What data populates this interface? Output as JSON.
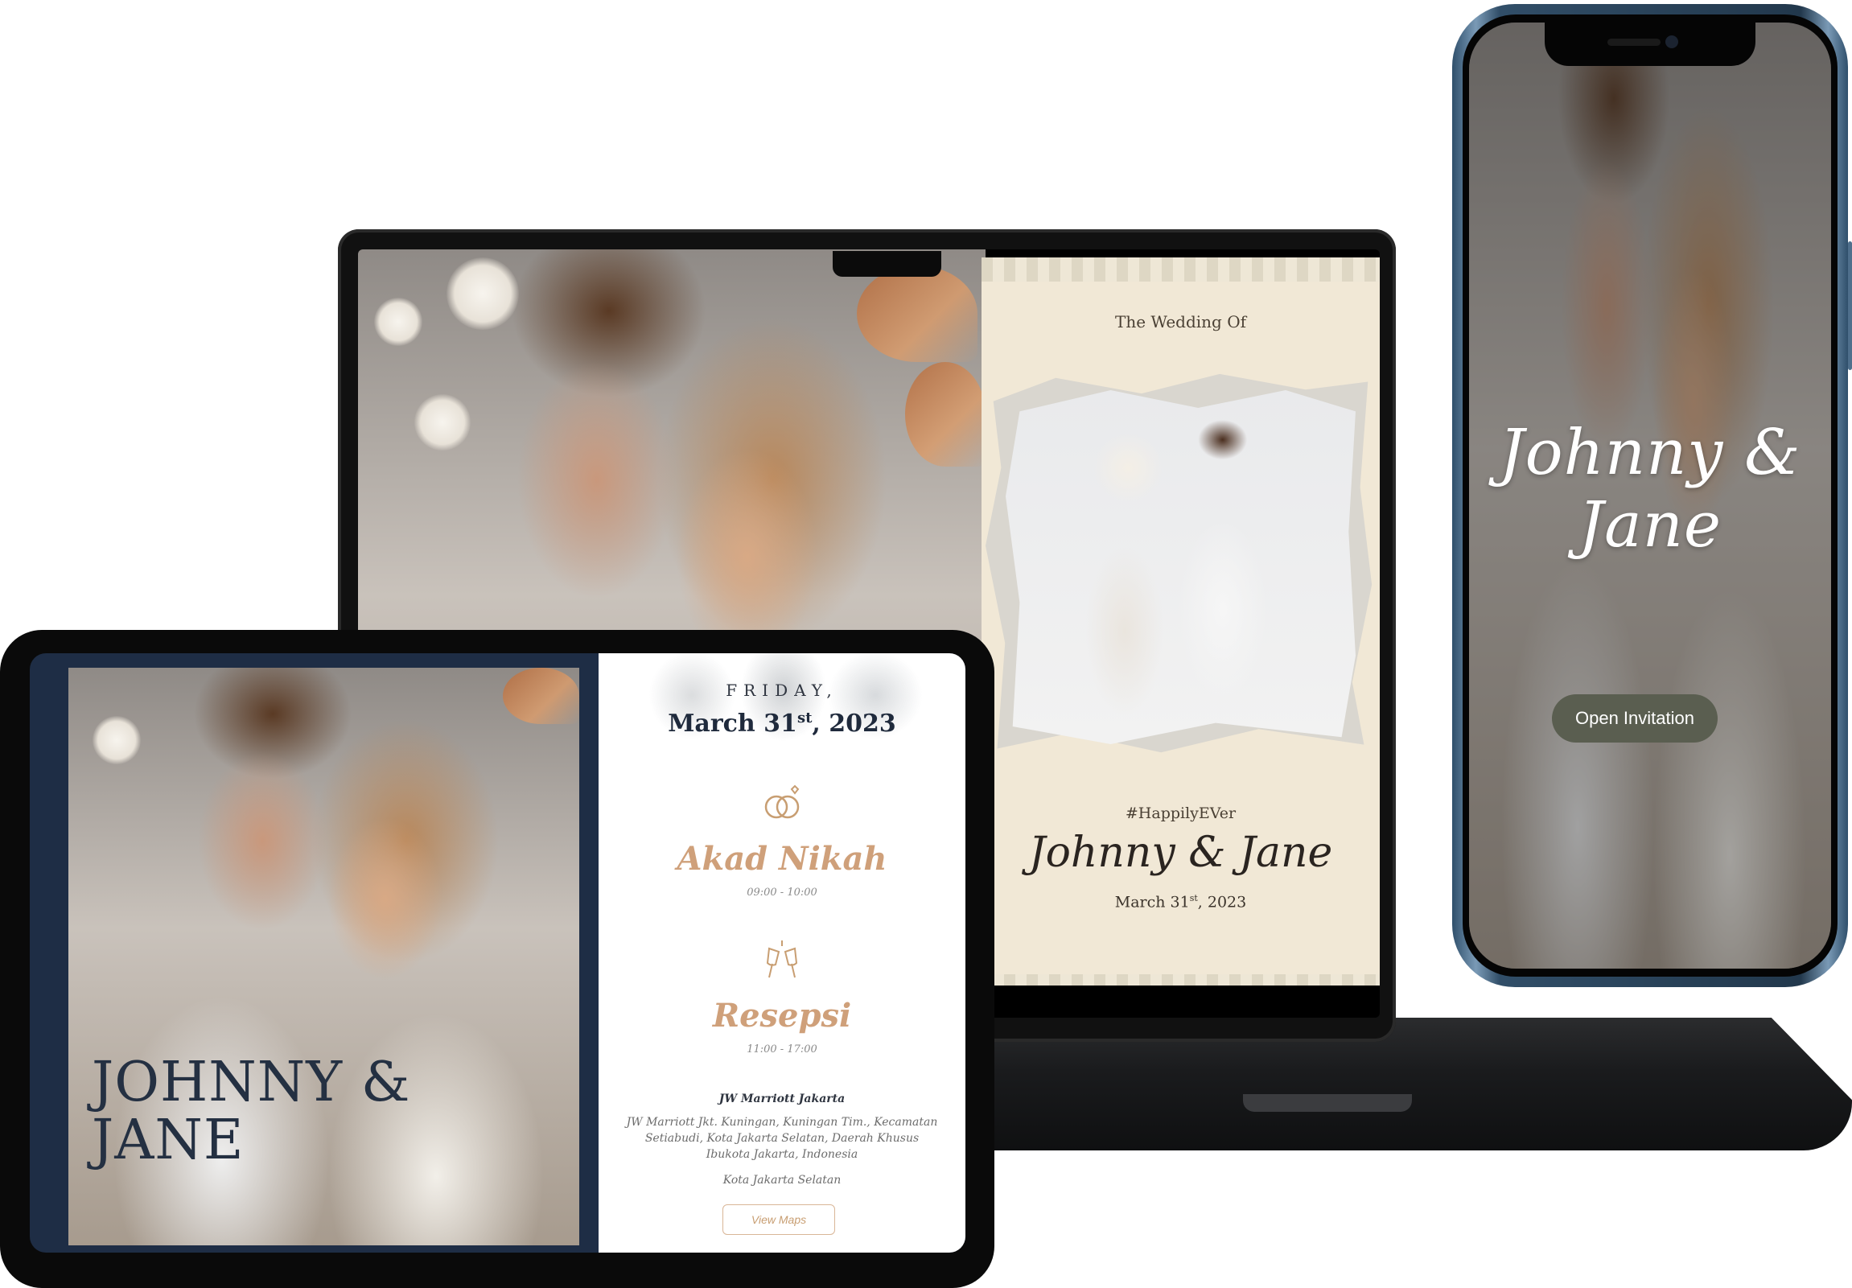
{
  "laptop": {
    "invitation": {
      "wedding_of": "The Wedding Of",
      "hashtag": "#HappilyEVer",
      "names": "Johnny & Jane",
      "date_main": "March 31",
      "date_sup": "st",
      "date_year": ", 2023"
    }
  },
  "phone": {
    "names": "Johnny & Jane",
    "open_button": "Open Invitation"
  },
  "tablet": {
    "names_line1": "JOHNNY &",
    "names_line2": "JANE",
    "day": "FRIDAY,",
    "date_main": "March 31",
    "date_sup": "st",
    "date_year": ", 2023",
    "akad": {
      "icon": "wedding-rings-icon",
      "title": "Akad Nikah",
      "time": "09:00 - 10:00"
    },
    "resepsi": {
      "icon": "champagne-toast-icon",
      "title": "Resepsi",
      "time": "11:00 - 17:00"
    },
    "venue": "JW Marriott Jakarta",
    "address": "JW Marriott Jkt. Kuningan, Kuningan Tim., Kecamatan Setiabudi, Kota Jakarta Selatan, Daerah Khusus Ibukota Jakarta, Indonesia",
    "city": "Kota Jakarta Selatan",
    "maps_button": "View Maps"
  },
  "colors": {
    "accent_gold": "#cfa07a",
    "navy": "#1e2d45",
    "cream": "#f1e8d6",
    "button_olive": "#5a5e50"
  }
}
